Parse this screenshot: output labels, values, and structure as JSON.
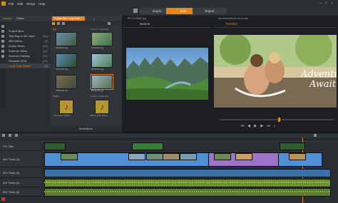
{
  "menu": [
    "File",
    "Edit",
    "Setup",
    "Help"
  ],
  "modes": [
    {
      "label": "Import",
      "active": false
    },
    {
      "label": "Edit",
      "active": true
    },
    {
      "label": "Export",
      "active": false
    }
  ],
  "library": {
    "tabs": [
      "Library",
      "Editor"
    ],
    "items": [
      {
        "label": "Project Bins",
        "count": "",
        "style": "normal"
      },
      {
        "label": "Two Day in the Land",
        "count": "(10)",
        "style": "normal"
      },
      {
        "label": "360 videos",
        "count": "(3)",
        "style": "normal"
      },
      {
        "label": "Action Shots",
        "count": "(42)",
        "style": "normal"
      },
      {
        "label": "Summer Hikes",
        "count": "(12)",
        "style": "normal"
      },
      {
        "label": "Summer Holiday",
        "count": "(32)",
        "style": "normal"
      },
      {
        "label": "Pinnacle 2018",
        "count": "(14)",
        "style": "normal"
      },
      {
        "label": "Long Yuan Beach",
        "count": "(6)",
        "style": "orange"
      }
    ]
  },
  "media": {
    "tab_label": "Project Bin: Long Yuan...",
    "header_left": "jpg",
    "header_right": "7 items, 1 selected",
    "thumbs": [
      {
        "label": "IMG8010.jpg"
      },
      {
        "label": "IMG8123.jpg"
      },
      {
        "label": "IMG8128.jpg"
      },
      {
        "label": "IMG8131.jpg"
      },
      {
        "label": "IMG8190.jpg"
      },
      {
        "label": "IMG8265.jpg"
      }
    ],
    "audio_section": "Audio",
    "audio_count": "2 items, 0 selected",
    "audio": [
      {
        "label": "pycreation_Relax..."
      },
      {
        "label": "tribute_(ind_anew..."
      }
    ],
    "bottom_label": "SmartMovie"
  },
  "source": {
    "filename": "IP171130587.jpg",
    "tab": "Source"
  },
  "timeline_preview": {
    "filename": "AdventureMovie.Movie.axp",
    "tab": "Timeline",
    "overlay_text_1": "Adventu",
    "overlay_text_2": "Await"
  },
  "tracks": [
    {
      "label": "T/V  Title"
    },
    {
      "label": "A/V Track (1)"
    },
    {
      "label": "A/V Track (2)"
    },
    {
      "label": "A/V Track (3)"
    },
    {
      "label": "A/V Track (4)"
    }
  ],
  "colors": {
    "accent": "#e8861a",
    "purple": "#9d72c9",
    "blue": "#4f8fd6",
    "audio_green": "#6c8f33"
  }
}
